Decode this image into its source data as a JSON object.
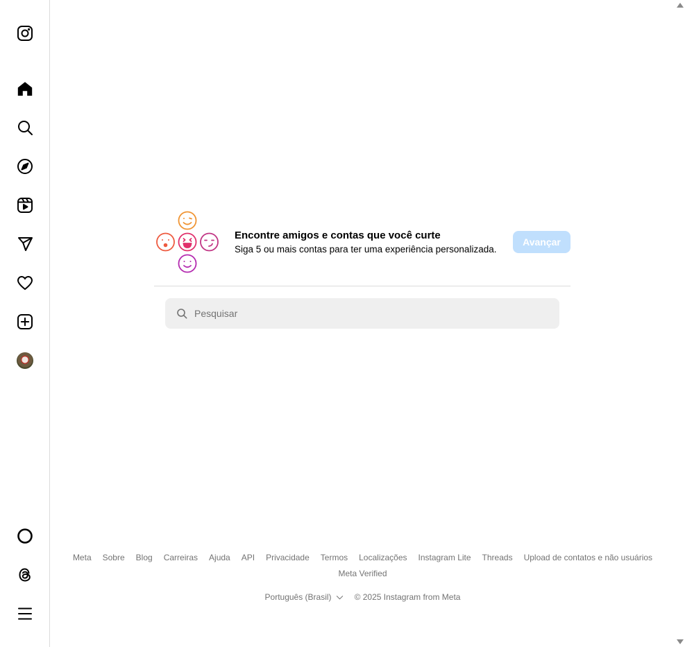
{
  "sidebar": {
    "items": [
      {
        "name": "instagram-logo-icon"
      },
      {
        "name": "home-icon"
      },
      {
        "name": "search-icon"
      },
      {
        "name": "explore-icon"
      },
      {
        "name": "reels-icon"
      },
      {
        "name": "messages-icon"
      },
      {
        "name": "notifications-icon"
      },
      {
        "name": "create-icon"
      },
      {
        "name": "profile-avatar"
      },
      {
        "name": "meta-ai-icon"
      },
      {
        "name": "threads-icon"
      },
      {
        "name": "menu-icon"
      }
    ]
  },
  "suggest": {
    "title": "Encontre amigos e contas que você curte",
    "subtitle": "Siga 5 ou mais contas para ter uma experiência personalizada.",
    "next_label": "Avançar"
  },
  "search": {
    "placeholder": "Pesquisar"
  },
  "footer": {
    "links": [
      "Meta",
      "Sobre",
      "Blog",
      "Carreiras",
      "Ajuda",
      "API",
      "Privacidade",
      "Termos",
      "Localizações",
      "Instagram Lite",
      "Threads",
      "Upload de contatos e não usuários",
      "Meta Verified"
    ],
    "language": "Português (Brasil)",
    "copyright": "© 2025 Instagram from Meta"
  },
  "colors": {
    "accent_disabled": "#c0dffd",
    "border": "#dbdbdb",
    "muted_text": "#737373",
    "search_bg": "#efefef"
  }
}
